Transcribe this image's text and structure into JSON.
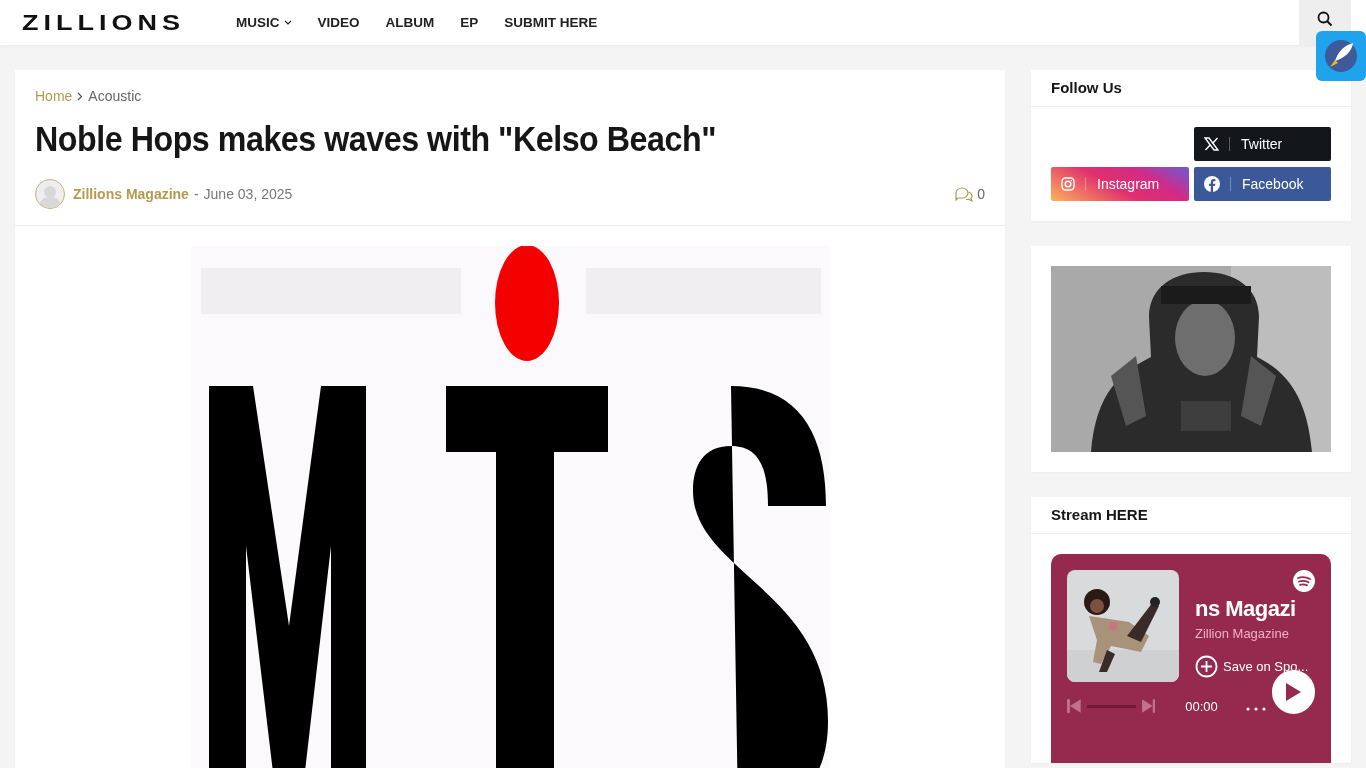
{
  "header": {
    "logo": "ZILLIONS",
    "nav": [
      {
        "label": "MUSIC",
        "has_dropdown": true
      },
      {
        "label": "VIDEO",
        "has_dropdown": false
      },
      {
        "label": "ALBUM",
        "has_dropdown": false
      },
      {
        "label": "EP",
        "has_dropdown": false
      },
      {
        "label": "SUBMIT HERE",
        "has_dropdown": false
      }
    ]
  },
  "post": {
    "breadcrumb": [
      "Home",
      "Acoustic"
    ],
    "title": "Noble Hops makes waves with \"Kelso Beach\"",
    "author": "Zillions Magazine",
    "separator": "-",
    "date": "June 03, 2025",
    "comments": "0",
    "image": {
      "kind": "picture"
    }
  },
  "sidebar": [
    {
      "kind": "social",
      "title": "Follow Us",
      "buttons": [
        {
          "label": "Twitter",
          "kind": "x"
        },
        {
          "label": "Instagram",
          "kind": "instagram"
        },
        {
          "label": "Facebook",
          "kind": "facebook"
        }
      ]
    },
    {
      "image": {
        "kind": "picture"
      }
    },
    {
      "kind": "spotify",
      "title": "Stream HERE",
      "track": "ns Magazi",
      "artist": "Zillion Magazine",
      "save": "Save on Spo...",
      "time": "00:00"
    }
  ]
}
